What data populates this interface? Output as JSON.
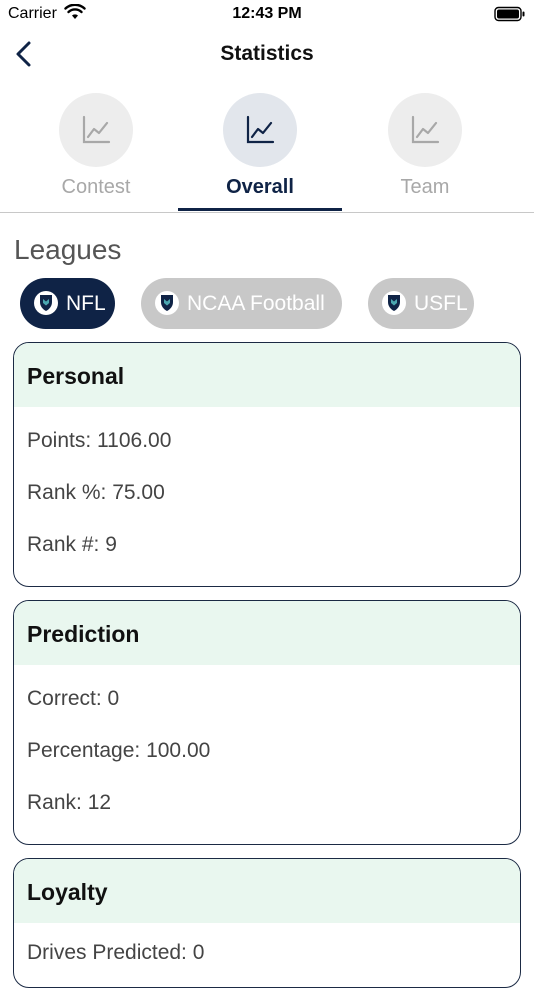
{
  "status": {
    "carrier": "Carrier",
    "time": "12:43 PM"
  },
  "nav": {
    "title": "Statistics"
  },
  "tabs": [
    {
      "label": "Contest",
      "active": false
    },
    {
      "label": "Overall",
      "active": true
    },
    {
      "label": "Team",
      "active": false
    }
  ],
  "leagues": {
    "title": "Leagues",
    "items": [
      {
        "label": "NFL",
        "selected": true
      },
      {
        "label": "NCAA Football",
        "selected": false
      },
      {
        "label": "USFL",
        "selected": false
      }
    ]
  },
  "cards": {
    "personal": {
      "title": "Personal",
      "rows": [
        "Points: 1106.00",
        "Rank %: 75.00",
        "Rank #: 9"
      ]
    },
    "prediction": {
      "title": "Prediction",
      "rows": [
        "Correct: 0",
        "Percentage: 100.00",
        "Rank: 12"
      ]
    },
    "loyalty": {
      "title": "Loyalty",
      "rows": [
        "Drives Predicted: 0"
      ]
    }
  },
  "colors": {
    "accent": "#0f2346",
    "card_header_bg": "#e9f7ef",
    "chip_inactive": "#c8c8c8",
    "tab_inactive_text": "#a8a8a8"
  },
  "icons": [
    "wifi-icon",
    "battery-icon",
    "back-chevron-icon",
    "line-chart-icon",
    "shield-logo-icon"
  ]
}
